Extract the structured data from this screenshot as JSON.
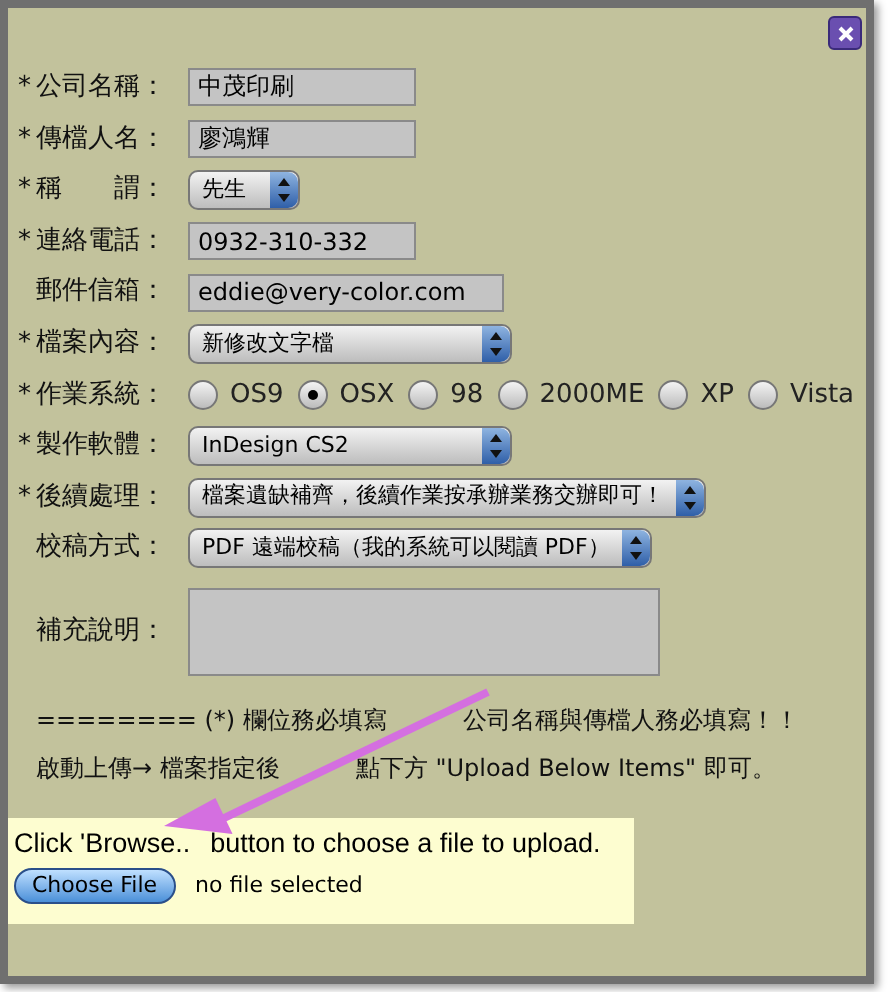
{
  "required_mark": "*",
  "fields": [
    {
      "kind": "text",
      "required": true,
      "label": "公司名稱：",
      "value": "中茂印刷"
    },
    {
      "kind": "text",
      "required": true,
      "label": "傳檔人名：",
      "value": "廖鴻輝"
    },
    {
      "kind": "select",
      "required": true,
      "label": "稱　　謂：",
      "value": "先生"
    },
    {
      "kind": "text",
      "required": true,
      "label": "連絡電話：",
      "value": "0932-310-332"
    },
    {
      "kind": "text",
      "required": false,
      "label": "郵件信箱：",
      "value": "eddie@very-color.com"
    },
    {
      "kind": "select",
      "required": true,
      "label": "檔案內容：",
      "value": "新修改文字檔"
    },
    {
      "kind": "radio",
      "required": true,
      "label": "作業系統：",
      "options": [
        {
          "label": "OS9",
          "selected": false
        },
        {
          "label": "OSX",
          "selected": true
        },
        {
          "label": "98",
          "selected": false
        },
        {
          "label": "2000ME",
          "selected": false
        },
        {
          "label": "XP",
          "selected": false
        },
        {
          "label": "Vista",
          "selected": false
        }
      ]
    },
    {
      "kind": "select",
      "required": true,
      "label": "製作軟體：",
      "value": "InDesign CS2"
    },
    {
      "kind": "select",
      "required": true,
      "label": "後續處理：",
      "value": "檔案遺缺補齊，後續作業按承辦業務交辦即可！"
    },
    {
      "kind": "select",
      "required": false,
      "label": "校稿方式：",
      "value": "PDF 遠端校稿（我的系統可以閱讀 PDF）"
    },
    {
      "kind": "textarea",
      "required": false,
      "label": "補充說明："
    }
  ],
  "notice_lines": [
    [
      "======== (*) 欄位務必填寫",
      "公司名稱與傳檔人務必填寫！！"
    ],
    [
      "啟動上傳→ 檔案指定後",
      "點下方 \"Upload Below Items\" 即可。"
    ]
  ],
  "upload": {
    "hint": [
      "Click 'Browse..",
      "button to choose a file to upload."
    ],
    "button": "Choose File",
    "status": "no file selected"
  }
}
